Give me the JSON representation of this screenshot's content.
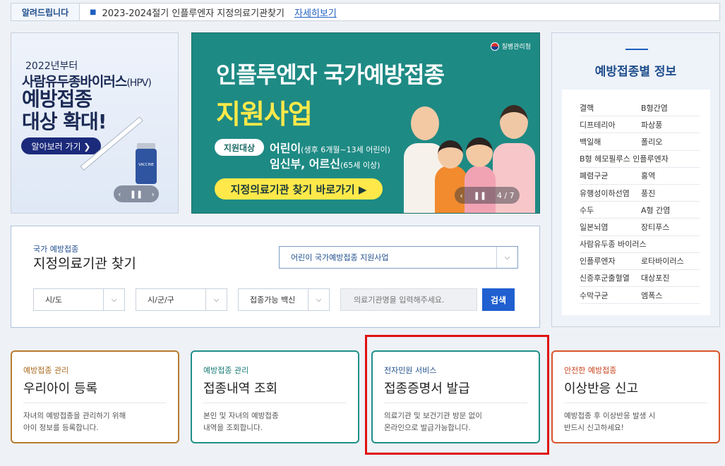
{
  "notice": {
    "label": "알려드립니다",
    "text": "2023-2024절기 인플루엔자 지정의료기관찾기",
    "link": "자세히보기"
  },
  "hpv_banner": {
    "line1": "2022년부터",
    "line2_main": "사람유두종바이러스",
    "line2_small": "(HPV)",
    "line3a": "예방접종",
    "line3b": "대상 확대!",
    "button": "알아보러 가기 ❯",
    "vial_label": "VACCINE",
    "prev": "‹",
    "pause": "❚❚",
    "next": "›"
  },
  "flu_banner": {
    "org": "질병관리청",
    "title1": "인플루엔자 국가예방접종",
    "title2": "지원사업",
    "target_label": "지원대상",
    "target1_main": "어린이",
    "target1_small": "(생후 6개월~13세 어린이)",
    "target2_main": "임신부, 어르신",
    "target2_small": "(65세 이상)",
    "find_button": "지정의료기관 찾기 바로가기 ▶",
    "prev": "‹",
    "pause": "❚❚",
    "page": "4 / 7"
  },
  "vaccine_info": {
    "title": "예방접종별 정보",
    "rows": [
      [
        "결핵",
        "B형간염"
      ],
      [
        "디프테리아",
        "파상풍"
      ],
      [
        "백일해",
        "폴리오"
      ],
      [
        "B형 헤모필루스 인플루엔자",
        ""
      ],
      [
        "폐렴구균",
        "홍역"
      ],
      [
        "유행성이하선염",
        "풍진"
      ],
      [
        "수두",
        "A형 간염"
      ],
      [
        "일본뇌염",
        "장티푸스"
      ],
      [
        "사람유두종 바이러스",
        ""
      ],
      [
        "인플루엔자",
        "로타바이러스"
      ],
      [
        "신증후군출혈열",
        "대상포진"
      ],
      [
        "수막구균",
        "엠폭스"
      ]
    ]
  },
  "search": {
    "subtitle": "국가 예방접종",
    "title": "지정의료기관 찾기",
    "program": "어린이 국가예방접종 지원사업",
    "sido": "시/도",
    "sigungu": "시/군/구",
    "vaccine": "접종가능 백신",
    "placeholder": "의료기관명을 입력해주세요.",
    "button": "검색",
    "chevron": "⌵"
  },
  "cards": [
    {
      "category": "예방접종 관리",
      "title": "우리아이 등록",
      "desc1": "자녀의 예방접종을 관리하기 위해",
      "desc2": "아이 정보를 등록합니다."
    },
    {
      "category": "예방접종 관리",
      "title": "접종내역 조회",
      "desc1": "본인 및 자녀의 예방접종",
      "desc2": "내역을 조회합니다."
    },
    {
      "category": "전자민원 서비스",
      "title": "접종증명서 발급",
      "desc1": "의료기관 및 보건기관 방문 없이",
      "desc2": "온라인으로 발급가능합니다."
    },
    {
      "category": "안전한 예방접종",
      "title": "이상반응 신고",
      "desc1": "예방접종 후 이상반응 발생 시",
      "desc2": "반드시 신고하세요!"
    }
  ]
}
